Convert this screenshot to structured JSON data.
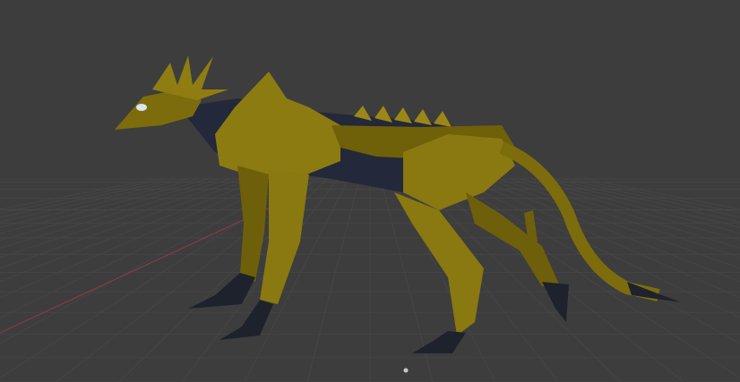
{
  "viewport": {
    "colors": {
      "background": "#3d3d3d",
      "grid": "#474747",
      "x_axis": "#8a3a44",
      "armor": "#7d6c0c",
      "armor_light": "#a08e1a",
      "armor_dark": "#4e4306",
      "body_dark": "#23283a",
      "claws": "#1e222c"
    },
    "origin_marker_icon": "origin-dot-icon"
  }
}
